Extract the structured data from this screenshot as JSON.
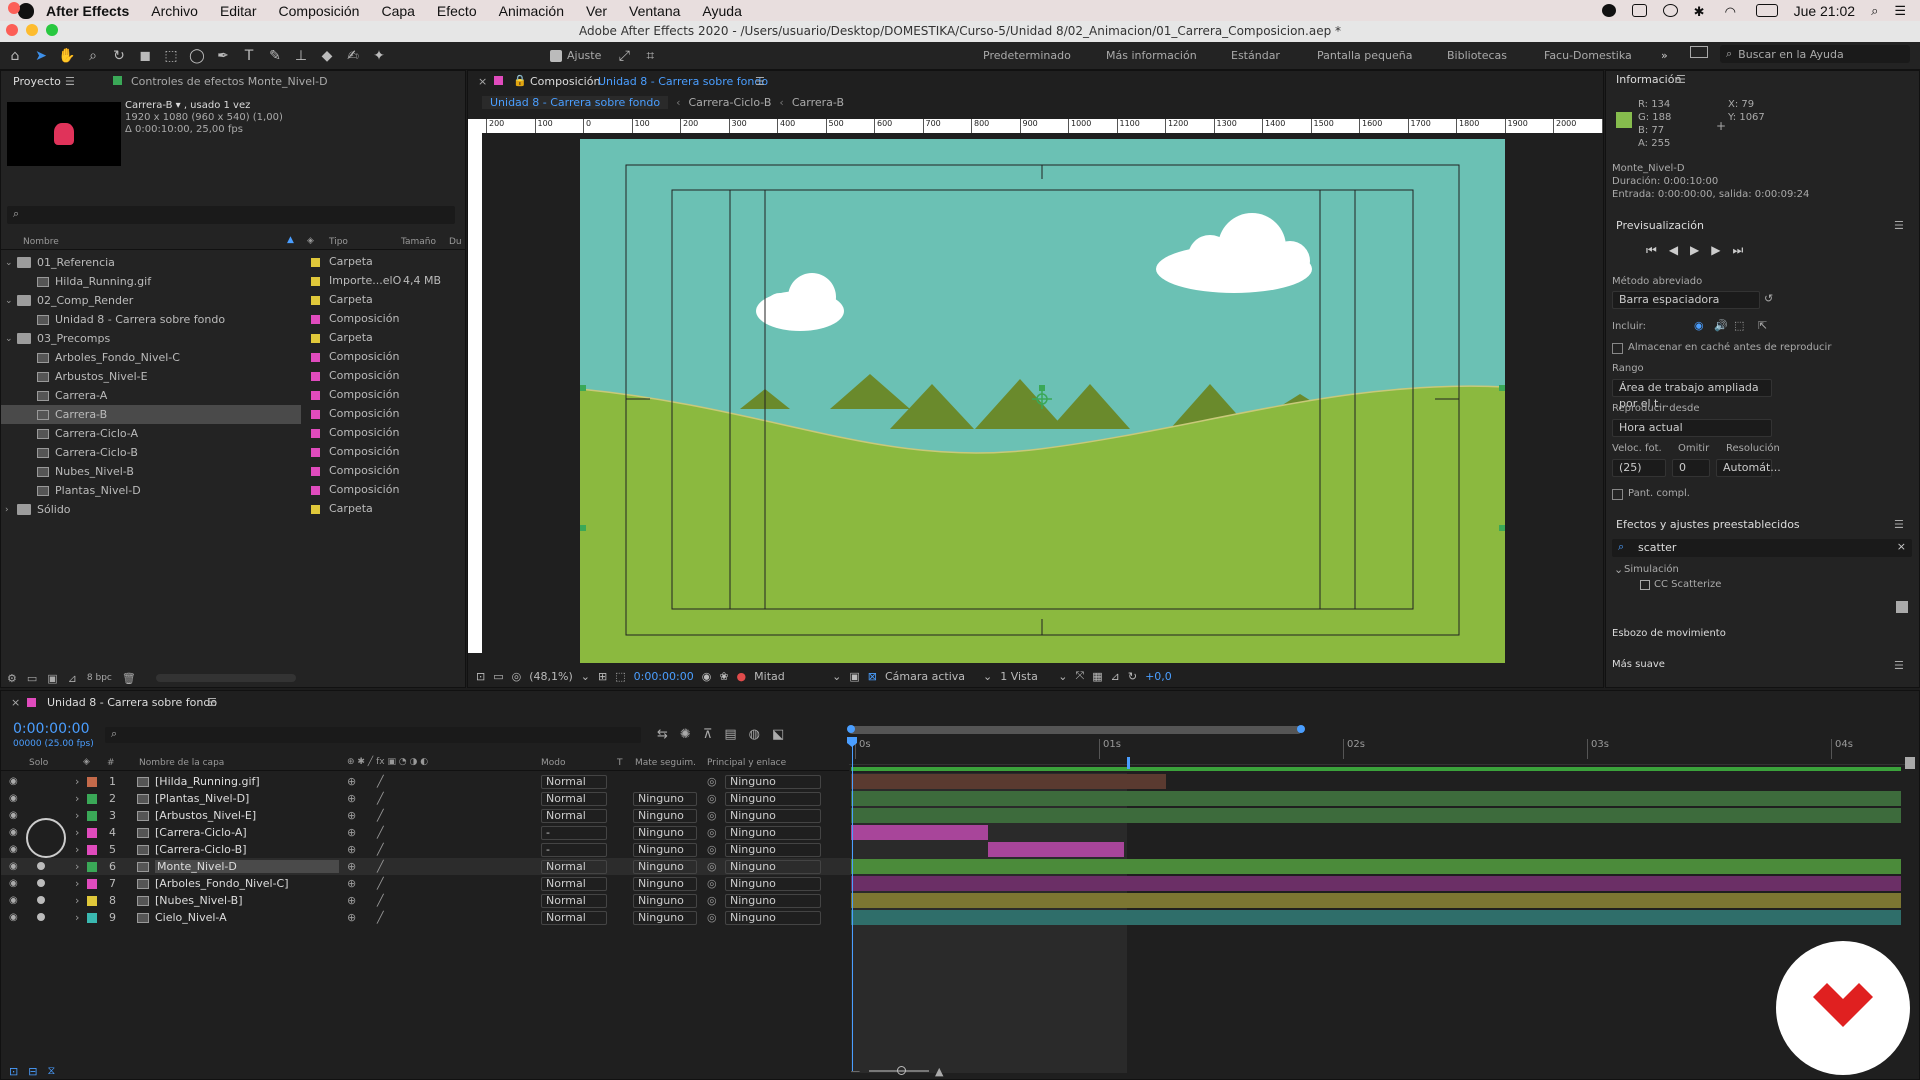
{
  "menubar": {
    "app": "After Effects",
    "items": [
      "Archivo",
      "Editar",
      "Composición",
      "Capa",
      "Efecto",
      "Animación",
      "Ver",
      "Ventana",
      "Ayuda"
    ],
    "clock": "Jue 21:02"
  },
  "window_title": "Adobe After Effects 2020 - /Users/usuario/Desktop/DOMESTIKA/Curso-5/Unidad 8/02_Animacion/01_Carrera_Composicion.aep *",
  "toolbar": {
    "ajuste_label": "Ajuste",
    "workspaces": [
      "Predeterminado",
      "Más información",
      "Estándar",
      "Pantalla pequeña",
      "Bibliotecas",
      "Facu-Domestika"
    ],
    "search_placeholder": "Buscar en la Ayuda"
  },
  "project": {
    "tab": "Proyecto",
    "effects_tab": "Controles de efectos Monte_Nivel-D",
    "preview_name": "Carrera-B ▾ , usado 1 vez",
    "preview_dims": "1920 x 1080  (960 x 540) (1,00)",
    "preview_dur": "Δ 0:00:10:00, 25,00 fps",
    "columns": {
      "name": "Nombre",
      "type": "Tipo",
      "size": "Tamaño",
      "dur": "Du"
    },
    "bpc": "8 bpc",
    "items": [
      {
        "name": "01_Referencia",
        "type": "Carpeta",
        "size": "",
        "color": "#e0c83a",
        "kind": "folder",
        "indent": 0
      },
      {
        "name": "Hilda_Running.gif",
        "type": "Importe...elO",
        "size": "4,4 MB",
        "color": "#e0c83a",
        "kind": "file",
        "indent": 1
      },
      {
        "name": "02_Comp_Render",
        "type": "Carpeta",
        "size": "",
        "color": "#e0c83a",
        "kind": "folder",
        "indent": 0
      },
      {
        "name": "Unidad 8 - Carrera sobre fondo",
        "type": "Composición",
        "size": "",
        "color": "#e04bbd",
        "kind": "comp",
        "indent": 1
      },
      {
        "name": "03_Precomps",
        "type": "Carpeta",
        "size": "",
        "color": "#e0c83a",
        "kind": "folder",
        "indent": 0
      },
      {
        "name": "Arboles_Fondo_Nivel-C",
        "type": "Composición",
        "size": "",
        "color": "#e04bbd",
        "kind": "comp",
        "indent": 1
      },
      {
        "name": "Arbustos_Nivel-E",
        "type": "Composición",
        "size": "",
        "color": "#e04bbd",
        "kind": "comp",
        "indent": 1
      },
      {
        "name": "Carrera-A",
        "type": "Composición",
        "size": "",
        "color": "#e04bbd",
        "kind": "comp",
        "indent": 1
      },
      {
        "name": "Carrera-B",
        "type": "Composición",
        "size": "",
        "color": "#e04bbd",
        "kind": "comp",
        "indent": 1
      },
      {
        "name": "Carrera-Ciclo-A",
        "type": "Composición",
        "size": "",
        "color": "#e04bbd",
        "kind": "comp",
        "indent": 1
      },
      {
        "name": "Carrera-Ciclo-B",
        "type": "Composición",
        "size": "",
        "color": "#e04bbd",
        "kind": "comp",
        "indent": 1
      },
      {
        "name": "Nubes_Nivel-B",
        "type": "Composición",
        "size": "",
        "color": "#e04bbd",
        "kind": "comp",
        "indent": 1
      },
      {
        "name": "Plantas_Nivel-D",
        "type": "Composición",
        "size": "",
        "color": "#e04bbd",
        "kind": "comp",
        "indent": 1
      },
      {
        "name": "Sólido",
        "type": "Carpeta",
        "size": "",
        "color": "#e0c83a",
        "kind": "folder",
        "indent": 0
      }
    ]
  },
  "composition": {
    "tab_prefix": "Composición",
    "tab_name": "Unidad 8 - Carrera sobre fondo",
    "breadcrumbs": [
      "Unidad 8 - Carrera sobre fondo",
      "Carrera-Ciclo-B",
      "Carrera-B"
    ],
    "ruler_labels": [
      "200",
      "100",
      "0",
      "100",
      "200",
      "300",
      "400",
      "500",
      "600",
      "700",
      "800",
      "900",
      "1000",
      "1100",
      "1200",
      "1300",
      "1400",
      "1500",
      "1600",
      "1700",
      "1800",
      "1900",
      "2000",
      "2100"
    ],
    "footer": {
      "zoom": "(48,1%)",
      "time": "0:00:00:00",
      "quality": "Mitad",
      "camera": "Cámara activa",
      "views": "1 Vista",
      "exposure": "+0,0"
    },
    "colors": {
      "sky": "#6bc1b4",
      "ground": "#8bb93f",
      "mountains": "#6a8a2c"
    }
  },
  "info": {
    "title": "Información",
    "r": "R:  134",
    "g": "G:  188",
    "b": "B:  77",
    "a": "A:  255",
    "x": "X:  79",
    "y": "Y:  1067",
    "swatch": "#86bc4d",
    "layer": "Monte_Nivel-D",
    "duration": "Duración: 0:00:10:00",
    "inout": "Entrada: 0:00:00:00, salida: 0:00:09:24"
  },
  "preview": {
    "title": "Previsualización",
    "shortcut_label": "Método abreviado",
    "shortcut_value": "Barra espaciadora",
    "include_label": "Incluir:",
    "cache_label": "Almacenar en caché antes de reproducir",
    "range_label": "Rango",
    "range_value": "Área de trabajo ampliada por el t...",
    "play_from_label": "Reproducir desde",
    "play_from_value": "Hora actual",
    "fps_label": "Veloc. fot.",
    "skip_label": "Omitir",
    "res_label": "Resolución",
    "fps_value": "(25)",
    "skip_value": "0",
    "res_value": "Automát...",
    "fullscreen_label": "Pant. compl."
  },
  "effects": {
    "title": "Efectos y ajustes preestablecidos",
    "search_value": "scatter",
    "category": "Simulación",
    "item": "CC Scatterize",
    "motion_sketch": "Esbozo de movimiento",
    "smoother": "Más suave"
  },
  "timeline": {
    "tab": "Unidad 8 - Carrera sobre fondo",
    "timecode": "0:00:00:00",
    "frames": "00000 (25.00 fps)",
    "col_solo": "Solo",
    "col_num": "#",
    "col_name": "Nombre de la capa",
    "col_mode": "Modo",
    "col_t": "T",
    "col_matte": "Mate seguim.",
    "col_parent": "Principal y enlace",
    "time_labels": [
      "0s",
      "01s",
      "02s",
      "03s",
      "04s"
    ],
    "layers": [
      {
        "num": "1",
        "name": "[Hilda_Running.gif]",
        "color": "#c46a4a",
        "mode": "Normal",
        "matte": "",
        "parent": "Ninguno",
        "bar_color": "#5a3a30",
        "bar_start": 0,
        "bar_end": 0.3
      },
      {
        "num": "2",
        "name": "[Plantas_Nivel-D]",
        "color": "#3aa857",
        "mode": "Normal",
        "matte": "Ninguno",
        "parent": "Ninguno",
        "bar_color": "#3d6b3c",
        "bar_start": 0,
        "bar_end": 1
      },
      {
        "num": "3",
        "name": "[Arbustos_Nivel-E]",
        "color": "#3aa857",
        "mode": "Normal",
        "matte": "Ninguno",
        "parent": "Ninguno",
        "bar_color": "#3d6b3c",
        "bar_start": 0,
        "bar_end": 1
      },
      {
        "num": "4",
        "name": "[Carrera-Ciclo-A]",
        "color": "#e04bbd",
        "mode": "-",
        "matte": "Ninguno",
        "parent": "Ninguno",
        "bar_color": "#a8459a",
        "bar_start": 0,
        "bar_end": 0.13
      },
      {
        "num": "5",
        "name": "[Carrera-Ciclo-B]",
        "color": "#e04bbd",
        "mode": "-",
        "matte": "Ninguno",
        "parent": "Ninguno",
        "bar_color": "#a8459a",
        "bar_start": 0.13,
        "bar_end": 0.26
      },
      {
        "num": "6",
        "name": "Monte_Nivel-D",
        "color": "#3aa857",
        "mode": "Normal",
        "matte": "Ninguno",
        "parent": "Ninguno",
        "bar_color": "#4b8b3a",
        "bar_start": 0,
        "bar_end": 1
      },
      {
        "num": "7",
        "name": "[Arboles_Fondo_Nivel-C]",
        "color": "#e04bbd",
        "mode": "Normal",
        "matte": "Ninguno",
        "parent": "Ninguno",
        "bar_color": "#6b2f66",
        "bar_start": 0,
        "bar_end": 1
      },
      {
        "num": "8",
        "name": "[Nubes_Nivel-B]",
        "color": "#e0c83a",
        "mode": "Normal",
        "matte": "Ninguno",
        "parent": "Ninguno",
        "bar_color": "#7c7632",
        "bar_start": 0,
        "bar_end": 1
      },
      {
        "num": "9",
        "name": "Cielo_Nivel-A",
        "color": "#3ab8b0",
        "mode": "Normal",
        "matte": "Ninguno",
        "parent": "Ninguno",
        "bar_color": "#2f6e6a",
        "bar_start": 0,
        "bar_end": 1
      }
    ]
  }
}
